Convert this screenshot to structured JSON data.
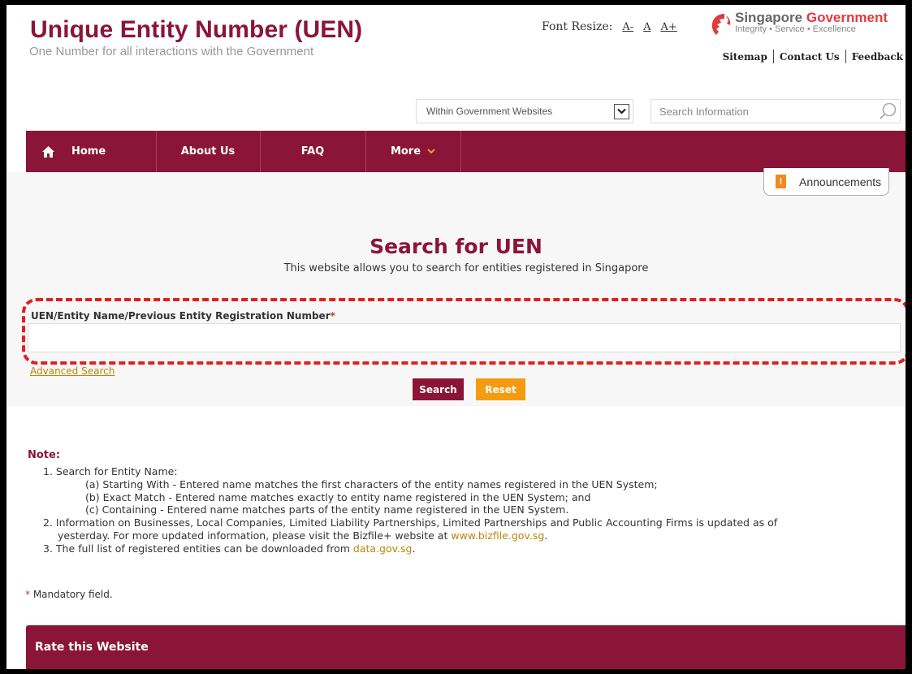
{
  "header": {
    "title": "Unique Entity Number (UEN)",
    "tagline": "One Number for all interactions with the Government",
    "font_resize_label": "Font Resize:",
    "font_sizes": [
      "A-",
      "A",
      "A+"
    ],
    "gov_brand_singapore": "Singapore",
    "gov_brand_government": "Government",
    "gov_motto": "Integrity • Service • Excellence",
    "links": [
      "Sitemap",
      "Contact Us",
      "Feedback"
    ]
  },
  "search": {
    "scope_selected": "Within Government Websites",
    "placeholder": "Search Information"
  },
  "nav": {
    "items": [
      "Home",
      "About Us",
      "FAQ",
      "More"
    ]
  },
  "announcements": {
    "label": "Announcements"
  },
  "main": {
    "heading": "Search for UEN",
    "subheading": "This website allows you to search for entities registered in Singapore",
    "field_label": "UEN/Entity Name/Previous Entity Registration Number",
    "required_mark": "*",
    "uen_value": "",
    "advanced_search": "Advanced Search",
    "search_button": "Search",
    "reset_button": "Reset"
  },
  "notes": {
    "title": "Note:",
    "item1": "1. Search for Entity Name:",
    "item1a": "(a) Starting With - Entered name matches the first characters of the entity names registered in the UEN System;",
    "item1b": "(b) Exact Match - Entered name matches exactly to entity name registered in the UEN System; and",
    "item1c": "(c) Containing - Entered name matches parts of the entity name registered in the UEN System.",
    "item2_line1": "2. Information on Businesses, Local Companies, Limited Liability Partnerships, Limited Partnerships and Public Accounting Firms is updated as of",
    "item2_line2_pre": "yesterday. For more updated information, please visit the Bizfile+ website at ",
    "item2_link": "www.bizfile.gov.sg",
    "item2_post": ".",
    "item3_pre": "3. The full list of registered entities can be downloaded from ",
    "item3_link": "data.gov.sg",
    "item3_post": "."
  },
  "footer": {
    "mandatory_mark": "*",
    "mandatory_text": " Mandatory field.",
    "rate_title": "Rate this Website"
  },
  "colors": {
    "brand": "#8b1538",
    "accent": "#f39c12",
    "link": "#b8860b",
    "highlight_dash": "#e02020"
  }
}
